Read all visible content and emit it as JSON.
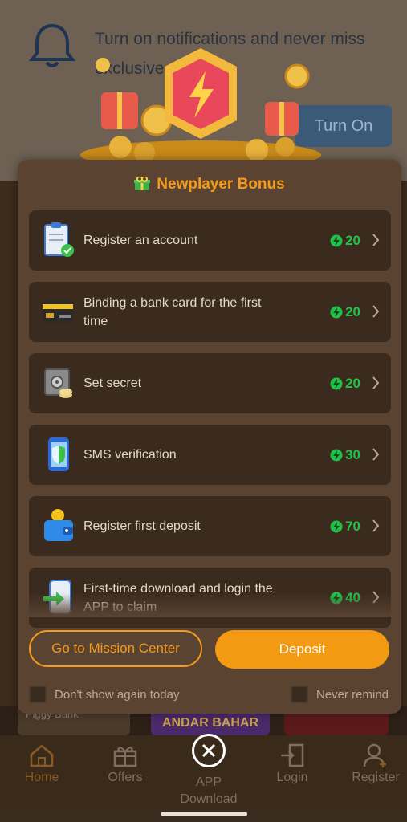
{
  "notification": {
    "text": "Turn on notifications and never miss exclusive",
    "button_label": "Turn On"
  },
  "modal": {
    "title": "Newplayer Bonus",
    "tasks": [
      {
        "label": "Register an account",
        "reward": "20",
        "icon": "clipboard-check-icon"
      },
      {
        "label": "Binding a bank card for the first time",
        "reward": "20",
        "icon": "bank-card-icon"
      },
      {
        "label": "Set secret",
        "reward": "20",
        "icon": "safe-icon"
      },
      {
        "label": "SMS verification",
        "reward": "30",
        "icon": "phone-shield-icon"
      },
      {
        "label": "Register first deposit",
        "reward": "70",
        "icon": "wallet-icon"
      },
      {
        "label": "First-time download and login the APP to claim",
        "reward": "40",
        "icon": "phone-download-icon"
      }
    ],
    "mission_button": "Go to Mission Center",
    "deposit_button": "Deposit",
    "dont_show_today": "Don't show again today",
    "never_remind": "Never remind"
  },
  "background": {
    "card_left": "Piggy Bank",
    "card_mid": "ANDAR BAHAR"
  },
  "nav": {
    "items": [
      {
        "label": "Home",
        "icon": "home-icon"
      },
      {
        "label": "Offers",
        "icon": "gift-box-icon"
      },
      {
        "label": "APP Download",
        "icon": "download-icon"
      },
      {
        "label": "Login",
        "icon": "login-icon"
      },
      {
        "label": "Register",
        "icon": "register-user-icon"
      }
    ]
  },
  "colors": {
    "accent": "#f59a1a",
    "reward": "#22c24a",
    "modal_bg": "#5a4331",
    "task_bg": "#3b2b1f"
  }
}
